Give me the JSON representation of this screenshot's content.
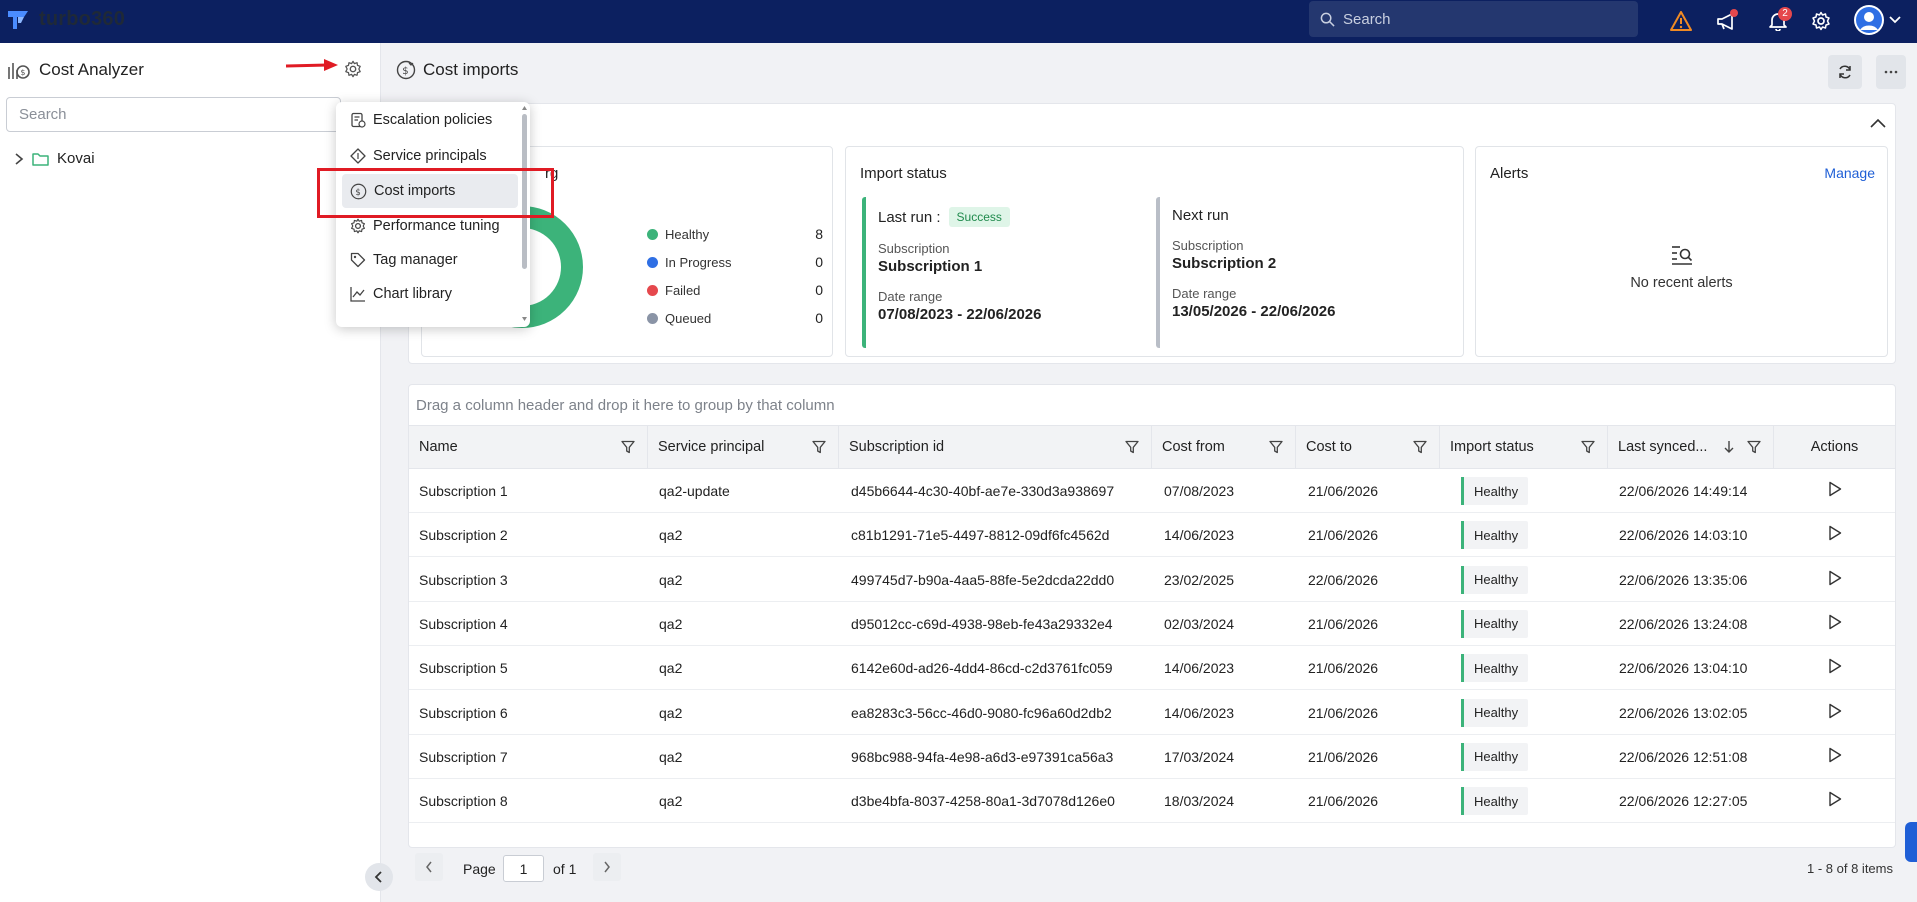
{
  "topbar": {
    "brand": "turbo360",
    "search_placeholder": "Search",
    "notification_count": "2",
    "icons": [
      "warning-icon",
      "announcement-icon",
      "bell-icon",
      "gear-icon",
      "avatar"
    ]
  },
  "sidebar": {
    "title": "Cost Analyzer",
    "search_placeholder": "Search",
    "tree": [
      {
        "label": "Kovai"
      }
    ]
  },
  "settings_menu": {
    "items": [
      {
        "label": "Escalation policies"
      },
      {
        "label": "Service principals"
      },
      {
        "label": "Cost imports",
        "active": true
      },
      {
        "label": "Performance tuning"
      },
      {
        "label": "Tag manager"
      },
      {
        "label": "Chart library"
      }
    ]
  },
  "page": {
    "title": "Cost imports"
  },
  "summary": {
    "overview_title_fragment": "rg",
    "legend": [
      {
        "label": "Healthy",
        "value": "8",
        "color": "#3cb37a"
      },
      {
        "label": "In Progress",
        "value": "0",
        "color": "#2f6fe4"
      },
      {
        "label": "Failed",
        "value": "0",
        "color": "#e5484d"
      },
      {
        "label": "Queued",
        "value": "0",
        "color": "#8a94a6"
      }
    ],
    "import_status": {
      "title": "Import status",
      "last_run": {
        "heading": "Last run :",
        "badge": "Success",
        "sub_label": "Subscription",
        "sub_value": "Subscription 1",
        "range_label": "Date range",
        "range_value": "07/08/2023 - 22/06/2026"
      },
      "next_run": {
        "heading": "Next run",
        "sub_label": "Subscription",
        "sub_value": "Subscription 2",
        "range_label": "Date range",
        "range_value": "13/05/2026 - 22/06/2026"
      }
    },
    "alerts": {
      "title": "Alerts",
      "manage": "Manage",
      "empty": "No recent alerts"
    }
  },
  "grid": {
    "group_hint": "Drag a column header and drop it here to group by that column",
    "columns": [
      "Name",
      "Service principal",
      "Subscription id",
      "Cost from",
      "Cost to",
      "Import status",
      "Last synced...",
      "Actions"
    ],
    "rows": [
      {
        "name": "Subscription 1",
        "sp": "qa2-update",
        "sub_id": "d45b6644-4c30-40bf-ae7e-330d3a938697",
        "from": "07/08/2023",
        "to": "21/06/2026",
        "status": "Healthy",
        "synced": "22/06/2026 14:49:14"
      },
      {
        "name": "Subscription 2",
        "sp": "qa2",
        "sub_id": "c81b1291-71e5-4497-8812-09df6fc4562d",
        "from": "14/06/2023",
        "to": "21/06/2026",
        "status": "Healthy",
        "synced": "22/06/2026 14:03:10"
      },
      {
        "name": "Subscription 3",
        "sp": "qa2",
        "sub_id": "499745d7-b90a-4aa5-88fe-5e2dcda22dd0",
        "from": "23/02/2025",
        "to": "22/06/2026",
        "status": "Healthy",
        "synced": "22/06/2026 13:35:06"
      },
      {
        "name": "Subscription 4",
        "sp": "qa2",
        "sub_id": "d95012cc-c69d-4938-98eb-fe43a29332e4",
        "from": "02/03/2024",
        "to": "21/06/2026",
        "status": "Healthy",
        "synced": "22/06/2026 13:24:08"
      },
      {
        "name": "Subscription 5",
        "sp": "qa2",
        "sub_id": "6142e60d-ad26-4dd4-86cd-c2d3761fc059",
        "from": "14/06/2023",
        "to": "21/06/2026",
        "status": "Healthy",
        "synced": "22/06/2026 13:04:10"
      },
      {
        "name": "Subscription 6",
        "sp": "qa2",
        "sub_id": "ea8283c3-56cc-46d0-9080-fc96a60d2db2",
        "from": "14/06/2023",
        "to": "21/06/2026",
        "status": "Healthy",
        "synced": "22/06/2026 13:02:05"
      },
      {
        "name": "Subscription 7",
        "sp": "qa2",
        "sub_id": "968bc988-94fa-4e98-a6d3-e97391ca56a3",
        "from": "17/03/2024",
        "to": "21/06/2026",
        "status": "Healthy",
        "synced": "22/06/2026 12:51:08"
      },
      {
        "name": "Subscription 8",
        "sp": "qa2",
        "sub_id": "d3be4bfa-8037-4258-80a1-3d7078d126e0",
        "from": "18/03/2024",
        "to": "21/06/2026",
        "status": "Healthy",
        "synced": "22/06/2026 12:27:05"
      }
    ]
  },
  "pager": {
    "page_label": "Page",
    "page_value": "1",
    "of_label": "of 1",
    "summary": "1 - 8 of 8 items"
  },
  "colors": {
    "topbar": "#0c2060",
    "healthy": "#3cb37a",
    "annotation": "#e01b24",
    "link": "#1f5fd6"
  }
}
